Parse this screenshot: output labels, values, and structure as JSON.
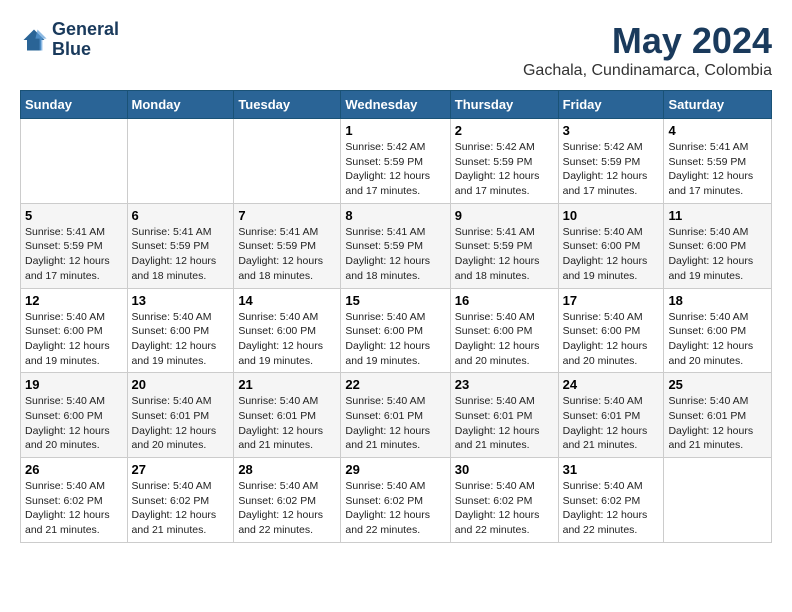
{
  "logo": {
    "line1": "General",
    "line2": "Blue"
  },
  "title": "May 2024",
  "subtitle": "Gachala, Cundinamarca, Colombia",
  "header_days": [
    "Sunday",
    "Monday",
    "Tuesday",
    "Wednesday",
    "Thursday",
    "Friday",
    "Saturday"
  ],
  "weeks": [
    [
      {
        "num": "",
        "info": ""
      },
      {
        "num": "",
        "info": ""
      },
      {
        "num": "",
        "info": ""
      },
      {
        "num": "1",
        "info": "Sunrise: 5:42 AM\nSunset: 5:59 PM\nDaylight: 12 hours\nand 17 minutes."
      },
      {
        "num": "2",
        "info": "Sunrise: 5:42 AM\nSunset: 5:59 PM\nDaylight: 12 hours\nand 17 minutes."
      },
      {
        "num": "3",
        "info": "Sunrise: 5:42 AM\nSunset: 5:59 PM\nDaylight: 12 hours\nand 17 minutes."
      },
      {
        "num": "4",
        "info": "Sunrise: 5:41 AM\nSunset: 5:59 PM\nDaylight: 12 hours\nand 17 minutes."
      }
    ],
    [
      {
        "num": "5",
        "info": "Sunrise: 5:41 AM\nSunset: 5:59 PM\nDaylight: 12 hours\nand 17 minutes."
      },
      {
        "num": "6",
        "info": "Sunrise: 5:41 AM\nSunset: 5:59 PM\nDaylight: 12 hours\nand 18 minutes."
      },
      {
        "num": "7",
        "info": "Sunrise: 5:41 AM\nSunset: 5:59 PM\nDaylight: 12 hours\nand 18 minutes."
      },
      {
        "num": "8",
        "info": "Sunrise: 5:41 AM\nSunset: 5:59 PM\nDaylight: 12 hours\nand 18 minutes."
      },
      {
        "num": "9",
        "info": "Sunrise: 5:41 AM\nSunset: 5:59 PM\nDaylight: 12 hours\nand 18 minutes."
      },
      {
        "num": "10",
        "info": "Sunrise: 5:40 AM\nSunset: 6:00 PM\nDaylight: 12 hours\nand 19 minutes."
      },
      {
        "num": "11",
        "info": "Sunrise: 5:40 AM\nSunset: 6:00 PM\nDaylight: 12 hours\nand 19 minutes."
      }
    ],
    [
      {
        "num": "12",
        "info": "Sunrise: 5:40 AM\nSunset: 6:00 PM\nDaylight: 12 hours\nand 19 minutes."
      },
      {
        "num": "13",
        "info": "Sunrise: 5:40 AM\nSunset: 6:00 PM\nDaylight: 12 hours\nand 19 minutes."
      },
      {
        "num": "14",
        "info": "Sunrise: 5:40 AM\nSunset: 6:00 PM\nDaylight: 12 hours\nand 19 minutes."
      },
      {
        "num": "15",
        "info": "Sunrise: 5:40 AM\nSunset: 6:00 PM\nDaylight: 12 hours\nand 19 minutes."
      },
      {
        "num": "16",
        "info": "Sunrise: 5:40 AM\nSunset: 6:00 PM\nDaylight: 12 hours\nand 20 minutes."
      },
      {
        "num": "17",
        "info": "Sunrise: 5:40 AM\nSunset: 6:00 PM\nDaylight: 12 hours\nand 20 minutes."
      },
      {
        "num": "18",
        "info": "Sunrise: 5:40 AM\nSunset: 6:00 PM\nDaylight: 12 hours\nand 20 minutes."
      }
    ],
    [
      {
        "num": "19",
        "info": "Sunrise: 5:40 AM\nSunset: 6:00 PM\nDaylight: 12 hours\nand 20 minutes."
      },
      {
        "num": "20",
        "info": "Sunrise: 5:40 AM\nSunset: 6:01 PM\nDaylight: 12 hours\nand 20 minutes."
      },
      {
        "num": "21",
        "info": "Sunrise: 5:40 AM\nSunset: 6:01 PM\nDaylight: 12 hours\nand 21 minutes."
      },
      {
        "num": "22",
        "info": "Sunrise: 5:40 AM\nSunset: 6:01 PM\nDaylight: 12 hours\nand 21 minutes."
      },
      {
        "num": "23",
        "info": "Sunrise: 5:40 AM\nSunset: 6:01 PM\nDaylight: 12 hours\nand 21 minutes."
      },
      {
        "num": "24",
        "info": "Sunrise: 5:40 AM\nSunset: 6:01 PM\nDaylight: 12 hours\nand 21 minutes."
      },
      {
        "num": "25",
        "info": "Sunrise: 5:40 AM\nSunset: 6:01 PM\nDaylight: 12 hours\nand 21 minutes."
      }
    ],
    [
      {
        "num": "26",
        "info": "Sunrise: 5:40 AM\nSunset: 6:02 PM\nDaylight: 12 hours\nand 21 minutes."
      },
      {
        "num": "27",
        "info": "Sunrise: 5:40 AM\nSunset: 6:02 PM\nDaylight: 12 hours\nand 21 minutes."
      },
      {
        "num": "28",
        "info": "Sunrise: 5:40 AM\nSunset: 6:02 PM\nDaylight: 12 hours\nand 22 minutes."
      },
      {
        "num": "29",
        "info": "Sunrise: 5:40 AM\nSunset: 6:02 PM\nDaylight: 12 hours\nand 22 minutes."
      },
      {
        "num": "30",
        "info": "Sunrise: 5:40 AM\nSunset: 6:02 PM\nDaylight: 12 hours\nand 22 minutes."
      },
      {
        "num": "31",
        "info": "Sunrise: 5:40 AM\nSunset: 6:02 PM\nDaylight: 12 hours\nand 22 minutes."
      },
      {
        "num": "",
        "info": ""
      }
    ]
  ],
  "colors": {
    "header_bg": "#2a6496",
    "header_text": "#ffffff",
    "title_color": "#1a3a5c"
  }
}
